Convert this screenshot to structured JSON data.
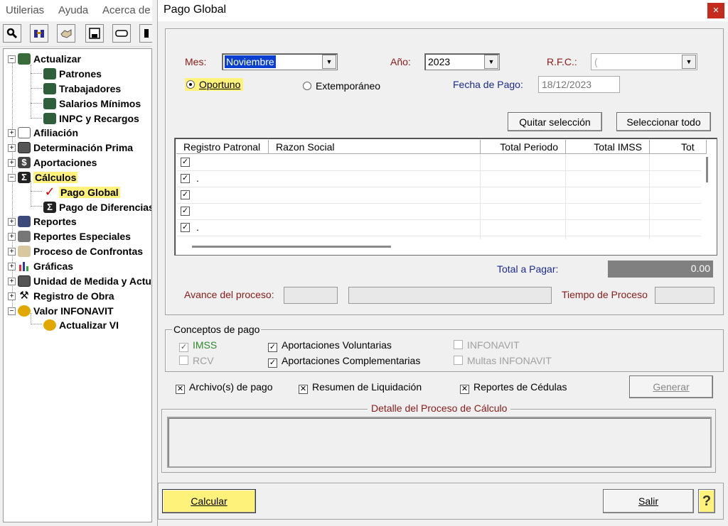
{
  "app": {
    "menu": [
      "Utilerias",
      "Ayuda",
      "Acerca de"
    ],
    "toolbar_icons": [
      "search-icon",
      "binoculars-icon",
      "handshake-icon",
      "save-icon",
      "eraser-icon",
      "tool-icon"
    ],
    "tree": {
      "nodes": [
        {
          "label": "Actualizar",
          "icon": "update-icon",
          "expander": "−",
          "level": 0
        },
        {
          "label": "Patrones",
          "icon": "people-icon",
          "level": 1
        },
        {
          "label": "Trabajadores",
          "icon": "people-icon",
          "level": 1
        },
        {
          "label": "Salarios Mínimos",
          "icon": "people-icon",
          "level": 1
        },
        {
          "label": "INPC y Recargos",
          "icon": "people-icon",
          "level": 1
        },
        {
          "label": "Afiliación",
          "icon": "document-icon",
          "expander": "+",
          "level": 0
        },
        {
          "label": "Determinación Prima",
          "icon": "calculator-icon",
          "expander": "+",
          "level": 0
        },
        {
          "label": "Aportaciones",
          "icon": "dollar-icon",
          "expander": "+",
          "level": 0
        },
        {
          "label": "Cálculos",
          "icon": "sigma-icon",
          "expander": "−",
          "level": 0,
          "highlight": true
        },
        {
          "label": "Pago Global",
          "icon": "checkmark-icon",
          "level": 1,
          "highlight": true
        },
        {
          "label": "Pago de Diferencias",
          "icon": "sigma-icon",
          "level": 1
        },
        {
          "label": "Reportes",
          "icon": "report-icon",
          "expander": "+",
          "level": 0
        },
        {
          "label": "Reportes Especiales",
          "icon": "printer-icon",
          "expander": "+",
          "level": 0
        },
        {
          "label": "Proceso de Confrontas",
          "icon": "handshake-icon",
          "expander": "+",
          "level": 0
        },
        {
          "label": "Gráficas",
          "icon": "chart-icon",
          "expander": "+",
          "level": 0
        },
        {
          "label": "Unidad de Medida y Actualización",
          "icon": "calculator-icon",
          "expander": "+",
          "level": 0
        },
        {
          "label": "Registro de Obra",
          "icon": "tools-icon",
          "expander": "+",
          "level": 0
        },
        {
          "label": "Valor INFONAVIT",
          "icon": "money-bag-icon",
          "expander": "−",
          "level": 0
        },
        {
          "label": "Actualizar VI",
          "icon": "money-bag-icon",
          "level": 1
        }
      ]
    }
  },
  "dialog": {
    "title": "Pago Global",
    "close": "×",
    "mes_label": "Mes:",
    "mes_value": "Noviembre",
    "anio_label": "Año:",
    "anio_value": "2023",
    "rfc_label": "R.F.C.:",
    "rfc_value": "(",
    "oportuno": "Oportuno",
    "extemporaneo": "Extemporáneo",
    "fecha_pago_label": "Fecha de Pago:",
    "fecha_pago_value": "18/12/2023",
    "quitar_seleccion": "Quitar selección",
    "seleccionar_todo": "Seleccionar todo",
    "grid": {
      "columns": [
        "Registro Patronal",
        "Razon Social",
        "Total Periodo",
        "Total IMSS",
        "Tot"
      ],
      "rows": [
        {
          "checked": true,
          "text": ""
        },
        {
          "checked": true,
          "text": "."
        },
        {
          "checked": true,
          "text": ""
        },
        {
          "checked": true,
          "text": ""
        },
        {
          "checked": true,
          "text": "."
        }
      ]
    },
    "total_pagar_label": "Total a Pagar:",
    "total_pagar_value": "0.00",
    "avance_label": "Avance del proceso:",
    "tiempo_label": "Tiempo de Proceso",
    "conceptos_title": "Conceptos de pago",
    "conceptos": {
      "imss": {
        "label": "IMSS",
        "checked": true
      },
      "rcv": {
        "label": "RCV",
        "checked": false
      },
      "aport_vol": {
        "label": "Aportaciones Voluntarias",
        "checked": true
      },
      "aport_comp": {
        "label": "Aportaciones Complementarias",
        "checked": true
      },
      "infonavit": {
        "label": "INFONAVIT",
        "checked": false
      },
      "multas": {
        "label": "Multas INFONAVIT",
        "checked": false
      }
    },
    "archivos_pago": "Archivo(s) de pago",
    "resumen_liquidacion": "Resumen de Liquidación",
    "reportes_cedulas": "Reportes de Cédulas",
    "generar": "Generar",
    "detalle_title": "Detalle del Proceso de Cálculo",
    "calcular": "Calcular",
    "salir": "Salir",
    "help": "?"
  },
  "colors": {
    "highlight": "#fff27a",
    "close_red": "#c42b1c",
    "label_red": "#8b1a1a",
    "label_blue": "#1c2a8c",
    "label_green": "#2a8a2a",
    "selection_blue": "#0a3fcf"
  }
}
